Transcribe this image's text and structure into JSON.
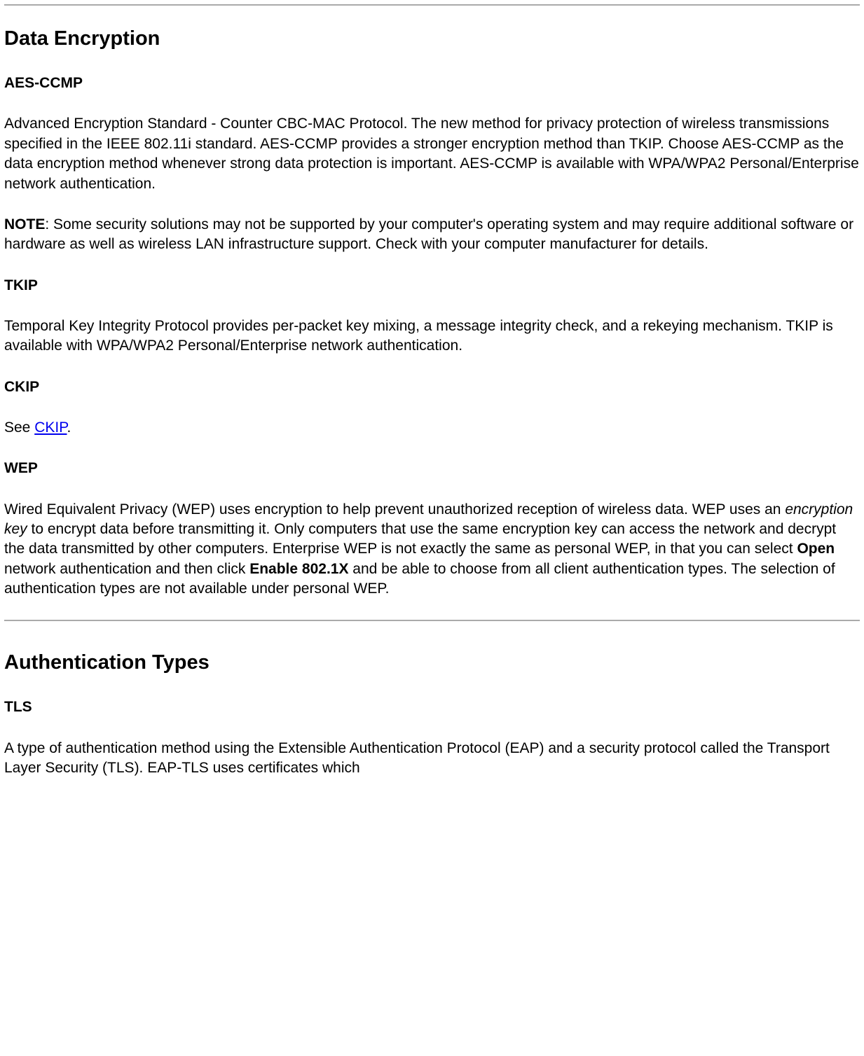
{
  "section1": {
    "heading": "Data Encryption",
    "aes": {
      "title": "AES-CCMP",
      "body": "Advanced Encryption Standard - Counter CBC-MAC Protocol. The new method for privacy protection of wireless transmissions specified in the IEEE 802.11i standard. AES-CCMP provides a stronger encryption method than TKIP. Choose AES-CCMP as the data encryption method whenever strong data protection is important. AES-CCMP is available with WPA/WPA2 Personal/Enterprise network authentication."
    },
    "note": {
      "label": "NOTE",
      "body": ": Some security solutions may not be supported by your computer's operating system and may require additional software or hardware as well as wireless LAN infrastructure support. Check with your computer manufacturer for details."
    },
    "tkip": {
      "title": "TKIP",
      "body": "Temporal Key Integrity Protocol provides per-packet key mixing, a message integrity check, and a rekeying mechanism. TKIP is available with WPA/WPA2 Personal/Enterprise network authentication."
    },
    "ckip": {
      "title": "CKIP",
      "prefix": "See ",
      "link": "CKIP",
      "suffix": "."
    },
    "wep": {
      "title": "WEP",
      "part1": "Wired Equivalent Privacy (WEP) uses encryption to help prevent unauthorized reception of wireless data. WEP uses an ",
      "italic": "encryption key",
      "part2": " to encrypt data before transmitting it. Only computers that use the same encryption key can access the network and decrypt the data transmitted by other computers. Enterprise WEP is not exactly the same as personal WEP, in that you can select ",
      "bold1": "Open",
      "part3": " network authentication and then click ",
      "bold2": "Enable 802.1X",
      "part4": " and be able to choose from all client authentication types. The selection of authentication types are not available under personal WEP."
    }
  },
  "section2": {
    "heading": "Authentication Types",
    "tls": {
      "title": "TLS",
      "body": "A type of authentication method using the Extensible Authentication Protocol (EAP) and a security protocol called the Transport Layer Security (TLS). EAP-TLS uses certificates which"
    }
  }
}
